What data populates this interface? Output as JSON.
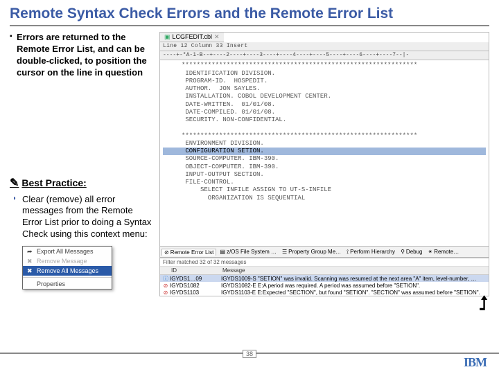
{
  "title": "Remote Syntax Check Errors and the Remote Error List",
  "bullet": "Errors are returned to the Remote Error List, and can be double-clicked, to position the cursor on the line in question",
  "best_practice": {
    "heading": "Best Practice:",
    "text": "Clear (remove) all error messages from the Remote Error List prior to doing a Syntax Check using this context menu:"
  },
  "context_menu": {
    "items": [
      {
        "label": "Export All Messages",
        "kind": "normal"
      },
      {
        "label": "Remove Message",
        "kind": "disabled"
      },
      {
        "label": "Remove All Messages",
        "kind": "selected"
      },
      {
        "label": "Properties",
        "kind": "normal"
      }
    ]
  },
  "editor": {
    "tab": "LCGFEDIT.cbl",
    "status": "Line 12    Column 33    Insert",
    "ruler": "----+-*A-1-B--+----2----+----3----+----4----+----5----+----6----+----7--|-",
    "lines": [
      "     ***************************************************************",
      "      IDENTIFICATION DIVISION.",
      "      PROGRAM-ID.  HOSPEDIT.",
      "      AUTHOR.  JON SAYLES.",
      "      INSTALLATION. COBOL DEVELOPMENT CENTER.",
      "      DATE-WRITTEN.  01/01/08.",
      "      DATE-COMPILED. 01/01/08.",
      "      SECURITY. NON-CONFIDENTIAL.",
      "",
      "     ***************************************************************",
      "      ENVIRONMENT DIVISION.",
      "      CONFIGURATION SETION.",
      "      SOURCE-COMPUTER. IBM-390.",
      "      OBJECT-COMPUTER. IBM-390.",
      "      INPUT-OUTPUT SECTION.",
      "      FILE-CONTROL.",
      "          SELECT INFILE ASSIGN TO UT-S-INFILE",
      "            ORGANIZATION IS SEQUENTIAL"
    ],
    "selected_line_index": 11,
    "error_marker_index": 11
  },
  "bottom_tabs": [
    {
      "label": "Remote Error List",
      "active": true,
      "icon": "error"
    },
    {
      "label": "z/OS File System …",
      "icon": "fs"
    },
    {
      "label": "Property Group Me…",
      "icon": "prop"
    },
    {
      "label": "Perform Hierarchy",
      "icon": "hier"
    },
    {
      "label": "Debug",
      "icon": "bug"
    },
    {
      "label": "Remote…",
      "icon": "remote"
    }
  ],
  "error_panel": {
    "filter_text": "Filter matched 32 of 32 messages",
    "headers": {
      "id": "ID",
      "message": "Message"
    },
    "rows": [
      {
        "icon": "I",
        "id": "IGYDS1…09",
        "msg": "IGYDS1009-S \"SETION\" was invalid.  Scanning was resumed at the next area \"A\" item, level-number, …",
        "sel": true
      },
      {
        "icon": "E",
        "id": "IGYDS1082",
        "msg": "IGYDS1082-E E:A period was required.  A period was assumed before \"SETION\"."
      },
      {
        "icon": "E",
        "id": "IGYDS1103",
        "msg": "IGYDS1103-E E:Expected \"SECTION\", but found \"SETION\".  \"SECTION\" was assumed before \"SETION\"."
      }
    ]
  },
  "page_number": "38",
  "logo": "IBM"
}
